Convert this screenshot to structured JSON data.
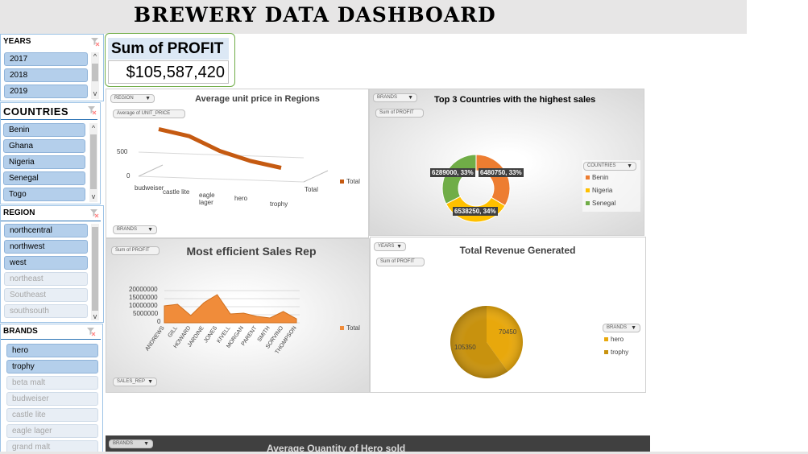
{
  "dashboard": {
    "title": "BREWERY DATA DASHBOARD"
  },
  "slicers": {
    "years": {
      "header": "YEARS",
      "items": [
        {
          "label": "2017",
          "selected": true
        },
        {
          "label": "2018",
          "selected": true
        },
        {
          "label": "2019",
          "selected": true
        }
      ]
    },
    "countries": {
      "header": "COUNTRIES",
      "items": [
        {
          "label": "Benin",
          "selected": true
        },
        {
          "label": "Ghana",
          "selected": true
        },
        {
          "label": "Nigeria",
          "selected": true
        },
        {
          "label": "Senegal",
          "selected": true
        },
        {
          "label": "Togo",
          "selected": true
        }
      ]
    },
    "region": {
      "header": "REGION",
      "items": [
        {
          "label": "northcentral",
          "selected": true
        },
        {
          "label": "northwest",
          "selected": true
        },
        {
          "label": "west",
          "selected": true
        },
        {
          "label": "northeast",
          "selected": false
        },
        {
          "label": "Southeast",
          "selected": false
        },
        {
          "label": "southsouth",
          "selected": false
        }
      ]
    },
    "brands": {
      "header": "BRANDS",
      "items": [
        {
          "label": "hero",
          "selected": true
        },
        {
          "label": "trophy",
          "selected": true
        },
        {
          "label": "beta malt",
          "selected": false
        },
        {
          "label": "budweiser",
          "selected": false
        },
        {
          "label": "castle lite",
          "selected": false
        },
        {
          "label": "eagle lager",
          "selected": false
        },
        {
          "label": "grand malt",
          "selected": false
        }
      ]
    }
  },
  "kpi": {
    "label": "Sum of PROFIT",
    "value": "$105,587,420"
  },
  "chart_data": [
    {
      "type": "line",
      "title": "Average unit price in Regions",
      "field_buttons": {
        "filter": "REGION",
        "value": "Average of UNIT_PRICE",
        "axis": "BRANDS"
      },
      "categories": [
        "budweiser",
        "castle lite",
        "eagle lager",
        "hero",
        "trophy"
      ],
      "series": [
        {
          "name": "Total",
          "values": [
            560,
            480,
            240,
            100,
            25
          ],
          "color": "#c55a11"
        }
      ],
      "ylim": [
        0,
        700
      ],
      "yticks": [
        "500",
        "0"
      ],
      "depth_label": "Total",
      "legend": "right"
    },
    {
      "type": "pie",
      "title": "Top 3 Countries with the highest sales",
      "field_buttons": {
        "filter": "BRANDS",
        "value": "Sum of PROFIT",
        "legend": "COUNTRIES"
      },
      "slices": [
        {
          "name": "Benin",
          "value": 6480750,
          "label": "6480750, 33%",
          "color": "#ed7d31"
        },
        {
          "name": "Nigeria",
          "value": 6538250,
          "label": "6538250, 34%",
          "color": "#ffc000"
        },
        {
          "name": "Senegal",
          "value": 6289000,
          "label": "6289000, 33%",
          "color": "#70ad47"
        }
      ],
      "legend": "right"
    },
    {
      "type": "area",
      "title": "Most efficient Sales Rep",
      "field_buttons": {
        "value": "Sum of PROFIT",
        "axis": "SALES_REP"
      },
      "categories": [
        "ANDREWS",
        "GILL",
        "HOWARD",
        "JARDINE",
        "JONES",
        "KIVELL",
        "MORGAN",
        "PARENT",
        "SMITH",
        "SORVINO",
        "THOMPSON"
      ],
      "series": [
        {
          "name": "Total",
          "values": [
            10500000,
            11500000,
            4500000,
            12500000,
            17500000,
            5500000,
            6000000,
            4000000,
            3000000,
            7000000,
            2500000
          ],
          "color": "#f08c3a"
        }
      ],
      "ylim": [
        0,
        20000000
      ],
      "yticks": [
        "20000000",
        "15000000",
        "10000000",
        "5000000",
        "0"
      ],
      "legend": "right"
    },
    {
      "type": "pie",
      "title": "Total Revenue Generated",
      "field_buttons": {
        "filter": "YEARS",
        "value": "Sum of PROFIT",
        "legend": "BRANDS"
      },
      "slices": [
        {
          "name": "hero",
          "value": 70450,
          "label": "70450",
          "color": "#e8a80c"
        },
        {
          "name": "trophy",
          "value": 105350,
          "label": "105350",
          "color": "#c8920e"
        }
      ],
      "legend": "right"
    },
    {
      "type": "bar",
      "title": "Average Quantity of Hero sold",
      "field_buttons": {
        "filter": "BRANDS"
      }
    }
  ]
}
